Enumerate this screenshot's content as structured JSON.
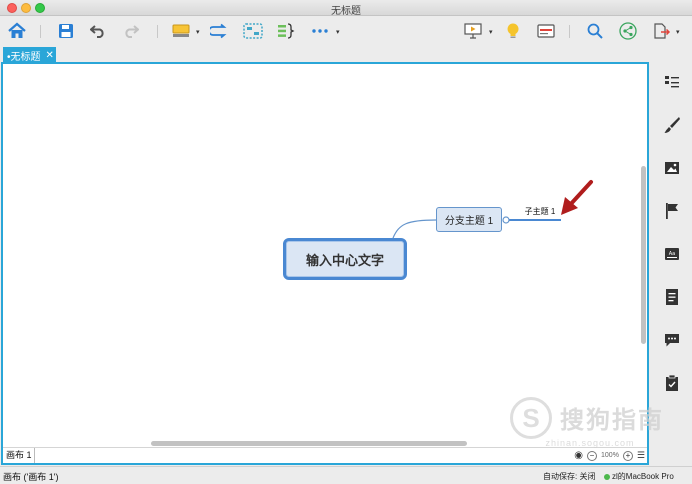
{
  "window": {
    "title": "无标题"
  },
  "tab": {
    "label": "•无标题",
    "close_glyph": "✕"
  },
  "mindmap": {
    "central_topic": "输入中心文字",
    "branch_topic": "分支主题 1",
    "sub_topic": "子主题 1"
  },
  "sheetbar": {
    "sheet_name": "画布 1",
    "zoom_label": "100%"
  },
  "statusbar": {
    "left": "画布 ('画布 1')",
    "autosave": "自动保存: 关闭",
    "user": "zl的MacBook Pro"
  },
  "watermark": {
    "logo_letter": "S",
    "text": "搜狗指南",
    "url": "zhinan.sogou.com"
  },
  "colors": {
    "accent": "#2aa6d8",
    "central_border": "#4a88d2",
    "topic_fill": "#dbe6f4",
    "arrow": "#b01d1d"
  },
  "toolbar": {
    "icons": [
      "home-icon",
      "save-icon",
      "undo-icon",
      "redo-icon",
      "insert-topic-icon",
      "relationship-icon",
      "boundary-icon",
      "summary-icon",
      "more-icon",
      "presentation-icon",
      "idea-icon",
      "outline-icon",
      "search-icon",
      "share-icon",
      "export-icon"
    ]
  },
  "sidebar": {
    "icons": [
      "outline-list-icon",
      "format-brush-icon",
      "image-icon",
      "marker-flag-icon",
      "text-style-icon",
      "notes-icon",
      "comment-icon",
      "task-clipboard-icon"
    ]
  }
}
